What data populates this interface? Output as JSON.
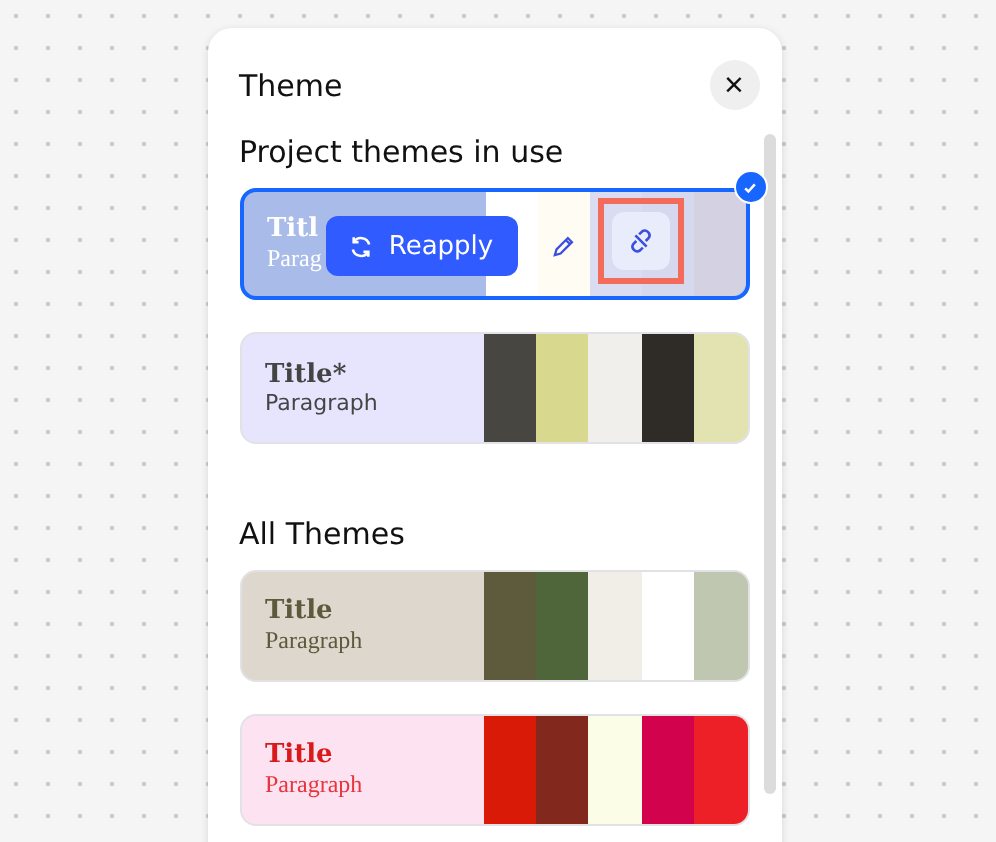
{
  "panel": {
    "title": "Theme",
    "close_label": "×"
  },
  "sections": [
    {
      "heading": "Project themes in use",
      "themes": [
        {
          "title": {
            "text": "Titl",
            "color": "#ffffff"
          },
          "paragraph": {
            "text": "Parag",
            "color": "#ffffff"
          },
          "selected": true,
          "color": "#a9bce9",
          "swatches": [
            {
              "color": "#ffffff"
            },
            {
              "color": "#fffcf3"
            },
            {
              "color": "#dadcf2"
            },
            {
              "color": "#d6d8ee"
            },
            {
              "color": "#d3d1e2"
            }
          ],
          "toolbar": {
            "reapply": "Reapply",
            "highlight_unlink": true
          }
        },
        {
          "title": {
            "text": "Title*",
            "color": "#444444"
          },
          "paragraph": {
            "text": "Paragraph",
            "color": "#444444"
          },
          "selected": false,
          "color": "#e7e5fd",
          "swatches": [
            {
              "color": "#474641"
            },
            {
              "color": "#d8d88e"
            },
            {
              "color": "#f0efeb"
            },
            {
              "color": "#2f2c27"
            },
            {
              "color": "#e2e3b0"
            }
          ]
        }
      ]
    },
    {
      "heading": "All Themes",
      "themes": [
        {
          "title": {
            "text": "Title",
            "color": "#5c5a3d"
          },
          "paragraph": {
            "text": "Paragraph",
            "color": "#5c5a3d"
          },
          "selected": false,
          "color": "#ded7cd",
          "swatches": [
            {
              "color": "#5e5b3d"
            },
            {
              "color": "#4f653a"
            },
            {
              "color": "#f1eee7"
            },
            {
              "color": "#ffffff"
            },
            {
              "color": "#bfc7b0"
            }
          ]
        },
        {
          "title": {
            "text": "Title",
            "color": "#d81a1a"
          },
          "paragraph": {
            "text": "Paragraph",
            "color": "#e8343c"
          },
          "selected": false,
          "color": "#fde3f1",
          "swatches": [
            {
              "color": "#d81a06"
            },
            {
              "color": "#82281c"
            },
            {
              "color": "#fbfde6"
            },
            {
              "color": "#d2024d"
            },
            {
              "color": "#ec2026"
            }
          ]
        }
      ]
    }
  ]
}
